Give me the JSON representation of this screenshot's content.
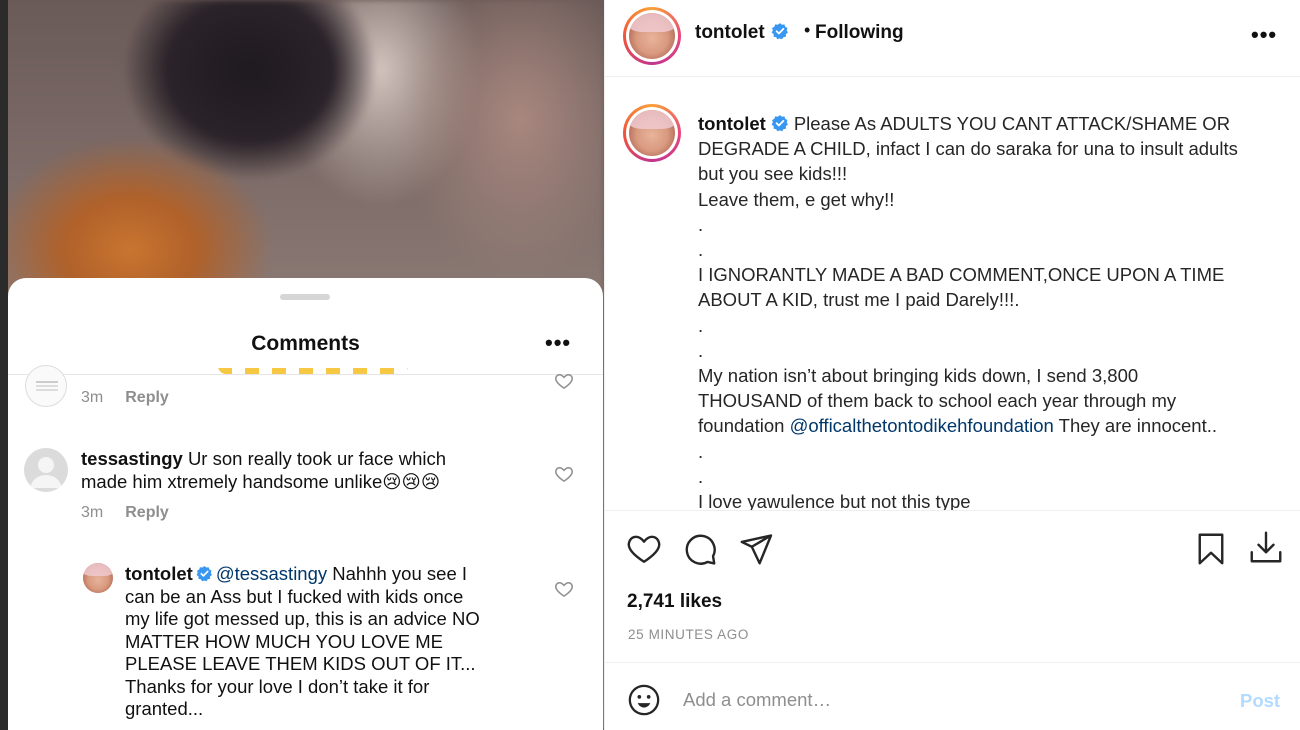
{
  "colors": {
    "accent": "#0095f6",
    "verified": "#3897f0",
    "muted": "#8e8e8e",
    "post_disabled": "#b3dbff",
    "link": "#00376b"
  },
  "comments_sheet": {
    "title": "Comments",
    "more_icon": "more-horizontal-icon",
    "comments": [
      {
        "avatar_icon": "user-avatar-icon",
        "time": "3m",
        "reply_label": "Reply"
      },
      {
        "username": "tessastingy",
        "text_line1": "Ur son really took ur face which",
        "text_line2": "made him xtremely handsome unlike😢😢😢",
        "time": "3m",
        "reply_label": "Reply"
      },
      {
        "username": "tontolet",
        "verified": true,
        "mention": "@tessastingy",
        "lines": [
          " Nahhh you see I",
          "can be an Ass but I fucked with kids once",
          "my life got messed up, this is an advice NO",
          "MATTER HOW MUCH YOU LOVE ME",
          "PLEASE LEAVE THEM KIDS OUT OF IT...",
          "Thanks for your love I don’t take it for",
          "granted..."
        ]
      }
    ]
  },
  "post": {
    "username": "tontolet",
    "verified": true,
    "separator": "•",
    "follow_state": "Following",
    "more_icon": "more-horizontal-icon",
    "caption_lines": [
      "Please As ADULTS YOU CANT ATTACK/SHAME OR",
      "DEGRADE A CHILD, infact I can do saraka for una to insult adults",
      "but you see kids!!!",
      "Leave them, e get why!!",
      ".",
      ".",
      "I IGNORANTLY MADE A BAD COMMENT,ONCE UPON A TIME",
      "ABOUT A KID, trust me I paid Darely!!!.",
      ".",
      ".",
      "My nation isn’t about bringing kids down, I send 3,800",
      "THOUSAND of them back to school each year through my",
      "foundation",
      "@officalthetontodikehfoundation",
      " They are innocent..",
      ".",
      ".",
      "I love yawulence but not this type"
    ],
    "actions": {
      "like_icon": "heart-icon",
      "comment_icon": "comment-bubble-icon",
      "share_icon": "send-icon",
      "save_icon": "bookmark-icon",
      "download_icon": "download-icon"
    },
    "likes": "2,741 likes",
    "time_ago": "25 MINUTES AGO",
    "add_comment": {
      "emoji_icon": "emoji-smiley-icon",
      "placeholder": "Add a comment…",
      "post_label": "Post"
    }
  }
}
